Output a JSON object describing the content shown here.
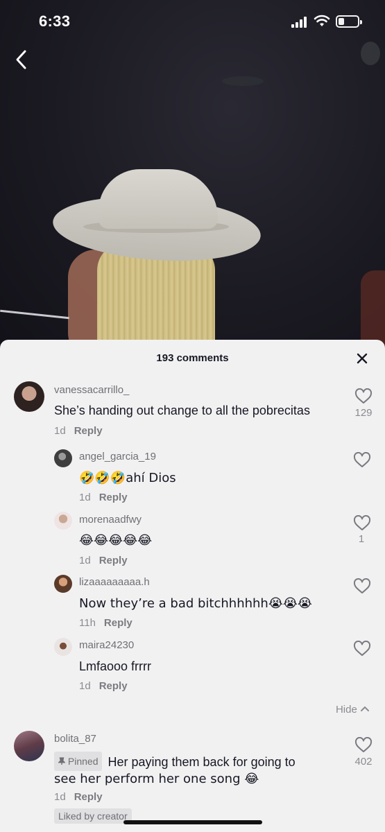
{
  "status_bar": {
    "time": "6:33"
  },
  "sheet": {
    "comment_count": "193 comments",
    "hide_label": "Hide",
    "comments": [
      {
        "username": "vanessacarrillo_",
        "text": "She’s handing out change to all the pobrecitas",
        "time": "1d",
        "reply": "Reply",
        "likes": "129",
        "avatar_color": "#3b2b27"
      },
      {
        "username": "angel_garcia_19",
        "text": "🤣🤣🤣ahí Dios",
        "time": "1d",
        "reply": "Reply",
        "likes": "",
        "avatar_color": "#5a5a5a"
      },
      {
        "username": "morenaadfwy",
        "text": "😂😂😂😂😂",
        "time": "1d",
        "reply": "Reply",
        "likes": "1",
        "avatar_color": "#b99a8a"
      },
      {
        "username": "lizaaaaaaaaa.h",
        "text": "Now they’re a bad bitchhhhhh😭😭😭",
        "time": "11h",
        "reply": "Reply",
        "likes": "",
        "avatar_color": "#c07a51"
      },
      {
        "username": "maira24230",
        "text": "Lmfaooo frrrr",
        "time": "1d",
        "reply": "Reply",
        "likes": "",
        "avatar_color": "#3a2a20"
      },
      {
        "username": "bolita_87",
        "pinned_label": "Pinned",
        "text_line1": "Her paying them back for going to",
        "text_line2": "see her perform her one song 😂",
        "time": "1d",
        "reply": "Reply",
        "likes": "402",
        "liked_by": "Liked by creator",
        "avatar_color": "#6c4a55"
      }
    ]
  },
  "icons": {
    "back": "chevron-left-icon",
    "close": "close-icon",
    "like": "heart-outline-icon",
    "hide": "chevron-up-icon",
    "pin": "pin-icon"
  }
}
